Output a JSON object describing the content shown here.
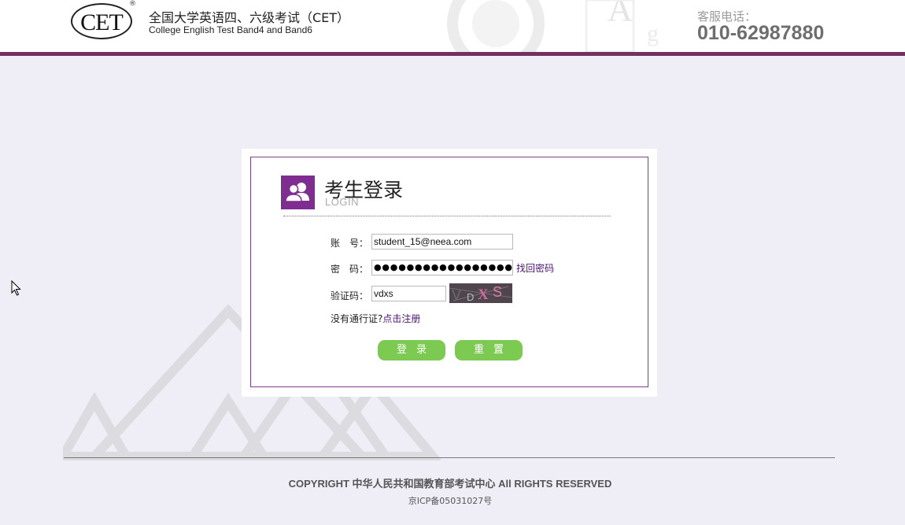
{
  "header": {
    "logo_text": "CET",
    "logo_registered": "®",
    "title": "全国大学英语四、六级考试（CET）",
    "subtitle": "College English Test Band4 and Band6",
    "hotline_label": "客服电话：",
    "hotline_number": "010-62987880"
  },
  "login": {
    "title": "考生登录",
    "subtitle": "LOGIN",
    "account_label": "账　号：",
    "account_value": "student_15@neea.com",
    "password_label": "密　码：",
    "password_mask": "●●●●●●●●●●●●●●●●●●●●●●",
    "forgot_password": "找回密码",
    "captcha_label": "验证码：",
    "captcha_value": "vdxs",
    "captcha_image_text": "VDXS",
    "no_pass_text": "没有通行证?",
    "register_link": "点击注册",
    "login_button": "登录",
    "reset_button": "重置"
  },
  "footer": {
    "copyright": "COPYRIGHT 中华人民共和国教育部考试中心 All RIGHTS RESERVED",
    "icp": "京ICP备05031027号"
  },
  "colors": {
    "brand_purple": "#72325f",
    "card_border": "#7f3f8c",
    "button_green": "#7cca52",
    "page_bg": "#efedf5"
  },
  "icons": [
    "users-icon",
    "cursor-icon"
  ]
}
